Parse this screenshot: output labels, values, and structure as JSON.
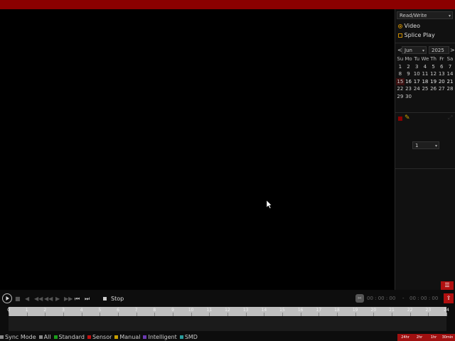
{
  "sidebar": {
    "mode_select": "Read/Write",
    "options": {
      "video_label": "Video",
      "splice_label": "Splice Play"
    },
    "calendar": {
      "month": "Jun",
      "year": "2025",
      "prev": "<",
      "next": ">",
      "weekdays": [
        "Su",
        "Mo",
        "Tu",
        "We",
        "Th",
        "Fr",
        "Sa"
      ],
      "weeks": [
        [
          "",
          "",
          "",
          "",
          "",
          "",
          ""
        ],
        [
          "1",
          "2",
          "3",
          "4",
          "5",
          "6",
          "7"
        ],
        [
          "8",
          "9",
          "10",
          "11",
          "12",
          "13",
          "14"
        ],
        [
          "15",
          "16",
          "17",
          "18",
          "19",
          "20",
          "21"
        ],
        [
          "22",
          "23",
          "24",
          "25",
          "26",
          "27",
          "28"
        ],
        [
          "29",
          "30",
          "",
          "",
          "",
          "",
          ""
        ]
      ]
    },
    "channel_select": "1"
  },
  "controls": {
    "stop_label": "Stop",
    "start_time": "00 : 00 : 00",
    "end_time": "00 : 00 : 00"
  },
  "timeline": {
    "hours": [
      "0",
      "1",
      "2",
      "3",
      "4",
      "5",
      "6",
      "7",
      "8",
      "9",
      "10",
      "11",
      "12",
      "13",
      "14",
      "15",
      "16",
      "17",
      "18",
      "19",
      "20",
      "21",
      "22",
      "23",
      "24"
    ]
  },
  "legend": {
    "sync": "Sync Mode",
    "all": "All",
    "standard": "Standard",
    "sensor": "Sensor",
    "manual": "Manual",
    "intelligent": "Intelligent",
    "smd": "SMD",
    "colors": {
      "all": "#888888",
      "standard": "#1aa01a",
      "sensor": "#c01010",
      "manual": "#c8a000",
      "intelligent": "#6a3ab0",
      "smd": "#2a9a9a"
    }
  },
  "speeds": [
    "24hr",
    "2hr",
    "1hr",
    "30min"
  ],
  "colors": {
    "accent": "#8b0000",
    "background": "#000000",
    "panel": "#111111"
  }
}
